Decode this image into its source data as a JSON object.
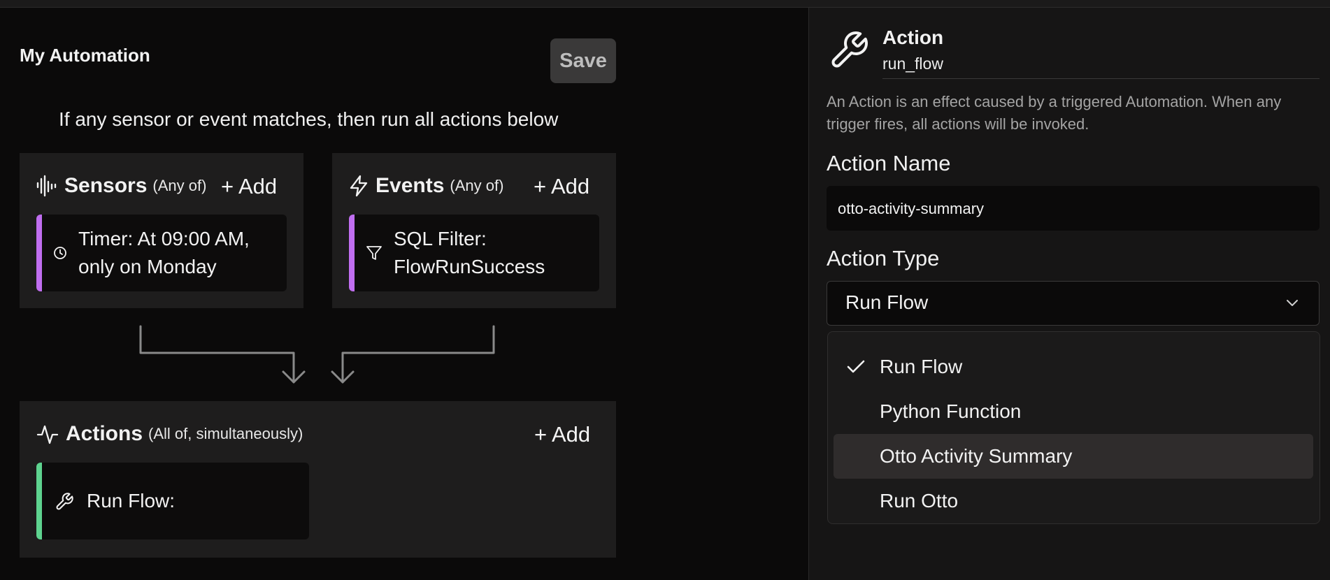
{
  "automation": {
    "title": "My Automation",
    "save_label": "Save",
    "subtitle": "If any sensor or event matches, then run all actions below"
  },
  "sensors": {
    "title": "Sensors",
    "qualifier": "(Any of)",
    "add_label": "+ Add",
    "icon": "waveform-icon",
    "items": [
      {
        "line1": "Timer: At 09:00 AM,",
        "line2": "only on Monday",
        "icon": "clock-icon",
        "accent": "#c06ef0"
      }
    ]
  },
  "events": {
    "title": "Events",
    "qualifier": "(Any of)",
    "add_label": "+ Add",
    "icon": "lightning-icon",
    "items": [
      {
        "line1": "SQL Filter:",
        "line2": "FlowRunSuccess",
        "icon": "filter-icon",
        "accent": "#c06ef0"
      }
    ]
  },
  "actions": {
    "title": "Actions",
    "qualifier": "(All of, simultaneously)",
    "add_label": "+ Add",
    "icon": "activity-icon",
    "items": [
      {
        "label": "Run Flow:",
        "icon": "wrench-icon",
        "accent": "#5ed38f"
      }
    ]
  },
  "detail": {
    "icon": "wrench-icon",
    "title": "Action",
    "subtitle": "run_flow",
    "description_line1": "An Action is an effect caused by a triggered Automation. When any",
    "description_line2": "trigger fires, all actions will be invoked.",
    "name_label": "Action Name",
    "name_value": "otto-activity-summary",
    "type_label": "Action Type",
    "type_value": "Run Flow",
    "type_options": [
      {
        "label": "Run Flow",
        "selected": true
      },
      {
        "label": "Python Function",
        "selected": false
      },
      {
        "label": "Otto Activity Summary",
        "selected": false,
        "highlighted": true
      },
      {
        "label": "Run Otto",
        "selected": false
      }
    ]
  },
  "colors": {
    "background": "#0b0a0a",
    "panel": "#1e1d1d",
    "sensor_accent": "#c06ef0",
    "action_accent": "#5ed38f"
  }
}
